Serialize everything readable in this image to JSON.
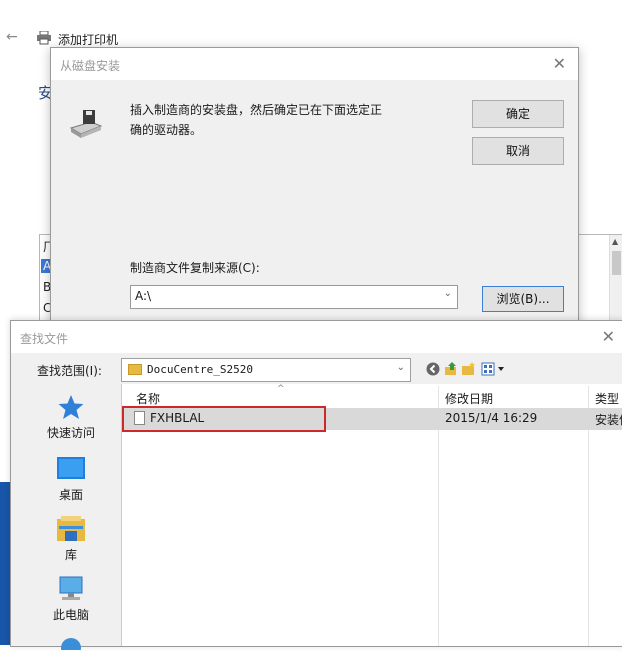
{
  "background": {
    "title": "添加打印机",
    "heading": "安",
    "list_letters": [
      "厂",
      "A",
      "B",
      "C"
    ]
  },
  "disk_dialog": {
    "title": "从磁盘安装",
    "message": "插入制造商的安装盘，然后确定已在下面选定正确的驱动器。",
    "ok": "确定",
    "cancel": "取消",
    "copy_label": "制造商文件复制来源(C):",
    "source_value": "A:\\",
    "browse": "浏览(B)..."
  },
  "find_dialog": {
    "title": "查找文件",
    "lookin_label": "查找范围(I):",
    "lookin_value": "DocuCentre_S2520",
    "places": [
      {
        "label": "快速访问",
        "icon": "star-icon"
      },
      {
        "label": "桌面",
        "icon": "desktop-icon"
      },
      {
        "label": "库",
        "icon": "library-icon"
      },
      {
        "label": "此电脑",
        "icon": "computer-icon"
      }
    ],
    "columns": {
      "name": "名称",
      "date": "修改日期",
      "type": "类型"
    },
    "files": [
      {
        "name": "FXHBLAL",
        "date": "2015/1/4 16:29",
        "type": "安装信"
      }
    ]
  },
  "colors": {
    "accent": "#3c7fd9",
    "highlight_border": "#cc2a2a",
    "selected_row": "#d9d9d9"
  }
}
